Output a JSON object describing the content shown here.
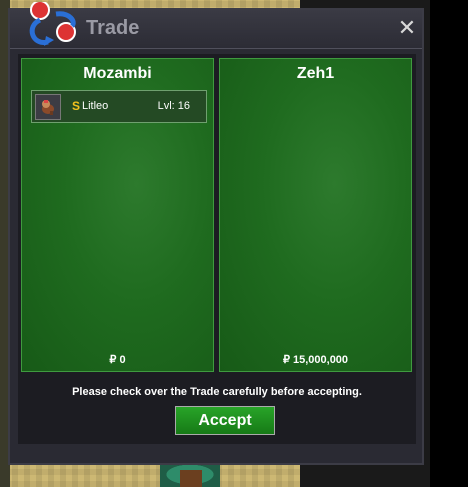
{
  "window": {
    "title": "Trade",
    "close_glyph": "✕"
  },
  "trade": {
    "left": {
      "player_name": "Mozambi",
      "items": [
        {
          "prefix": "S",
          "name": "Litleo",
          "level": "Lvl: 16",
          "icon": "litleo-sprite-icon"
        }
      ],
      "money": "₽ 0"
    },
    "right": {
      "player_name": "Zeh1",
      "items": [],
      "money": "₽ 15,000,000"
    }
  },
  "footer": {
    "note": "Please check over the Trade carefully before accepting.",
    "accept_label": "Accept"
  },
  "colors": {
    "panel_green": "#1f6b1f",
    "accept_green": "#1e8f1e",
    "shiny_gold": "#f2c21e"
  }
}
